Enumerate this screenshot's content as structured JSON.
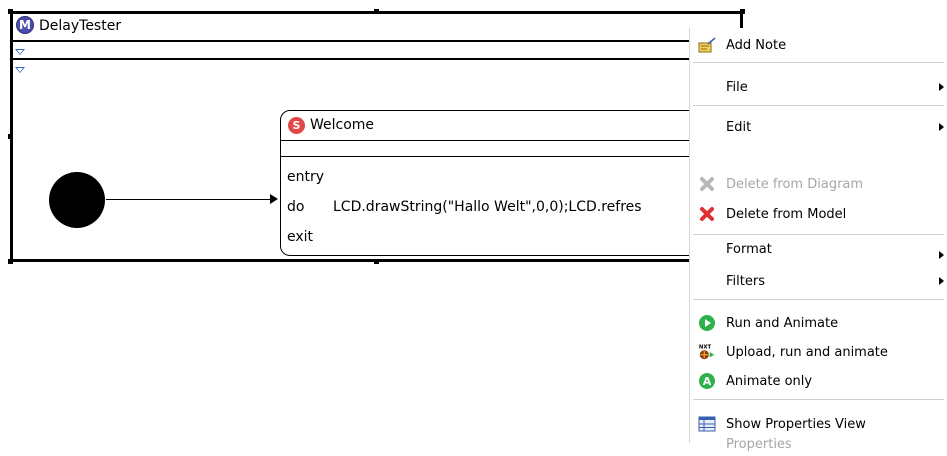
{
  "diagram": {
    "machine": {
      "badge": "M",
      "title": "DelayTester"
    },
    "state": {
      "badge": "S",
      "title": "Welcome",
      "entry_label": "entry",
      "do_label": "do",
      "do_code": "LCD.drawString(\"Hallo Welt\",0,0);LCD.refres",
      "exit_label": "exit"
    }
  },
  "context_menu": {
    "add_note": "Add Note",
    "file": "File",
    "edit": "Edit",
    "delete_from_diagram": "Delete from Diagram",
    "delete_from_model": "Delete from Model",
    "format": "Format",
    "filters": "Filters",
    "run_and_animate": "Run and Animate",
    "upload_run_animate": "Upload, run and animate",
    "upload_icon_text": "NXT",
    "animate_only": "Animate only",
    "animate_icon_text": "A",
    "show_properties_view": "Show Properties View",
    "properties": "Properties"
  },
  "colors": {
    "machine_badge": "#4b4ba8",
    "state_badge": "#e24848",
    "run_green": "#2db14a",
    "delete_red": "#e03030",
    "disabled_text": "#a6a6a6"
  }
}
